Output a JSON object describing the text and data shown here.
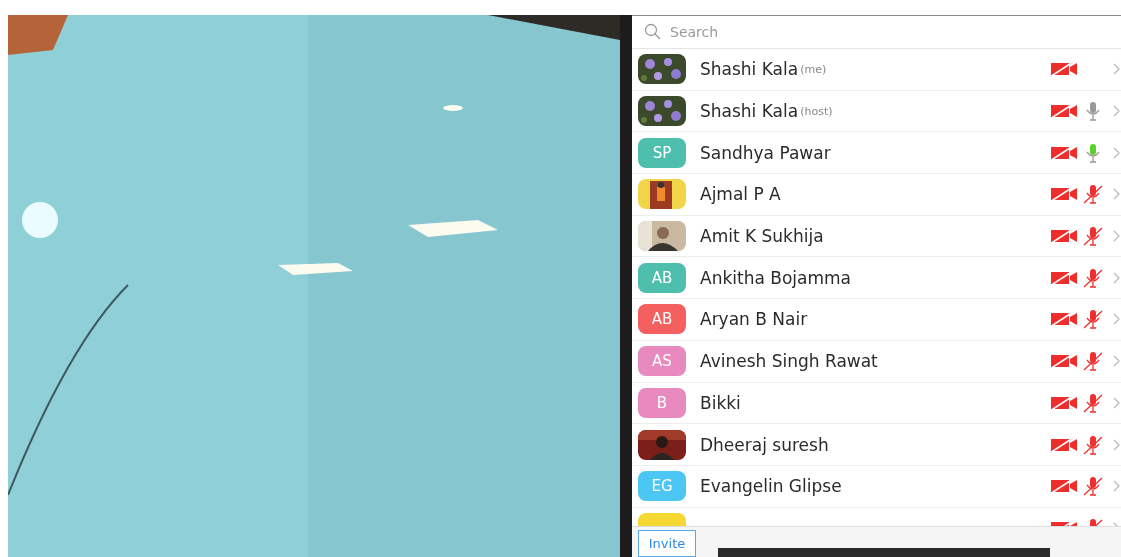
{
  "participants_panel": {
    "search": {
      "placeholder": "Search"
    },
    "participants": [
      {
        "name": "Shashi Kala",
        "tag": "(me)",
        "kind": "flowers",
        "video_off": true
      },
      {
        "name": "Shashi Kala",
        "tag": "(host)",
        "kind": "flowers",
        "video_off": true,
        "mic": {
          "muted": false,
          "speaking": false
        }
      },
      {
        "name": "Sandhya Pawar",
        "kind": "initials",
        "initials": "SP",
        "color": "#4fbfad",
        "video_off": true,
        "mic": {
          "muted": false,
          "speaking": true
        }
      },
      {
        "name": "Ajmal P A",
        "kind": "doorway",
        "video_off": true,
        "mic": {
          "muted": true
        }
      },
      {
        "name": "Amit K Sukhija",
        "kind": "portrait",
        "video_off": true,
        "mic": {
          "muted": true
        }
      },
      {
        "name": "Ankitha Bojamma",
        "kind": "initials",
        "initials": "AB",
        "color": "#4fbfad",
        "video_off": true,
        "mic": {
          "muted": true
        }
      },
      {
        "name": "Aryan B Nair",
        "kind": "initials",
        "initials": "AB",
        "color": "#f45f60",
        "video_off": true,
        "mic": {
          "muted": true
        }
      },
      {
        "name": "Avinesh Singh Rawat",
        "kind": "initials",
        "initials": "AS",
        "color": "#e889bf",
        "video_off": true,
        "mic": {
          "muted": true
        }
      },
      {
        "name": "Bikki",
        "kind": "initials",
        "initials": "B",
        "color": "#e889bf",
        "video_off": true,
        "mic": {
          "muted": true
        }
      },
      {
        "name": "Dheeraj suresh",
        "kind": "dark-portrait",
        "video_off": true,
        "mic": {
          "muted": true
        }
      },
      {
        "name": "Evangelin Glipse",
        "kind": "initials",
        "initials": "EG",
        "color": "#4cc6f2",
        "video_off": true,
        "mic": {
          "muted": true
        }
      },
      {
        "kind": "initials",
        "color": "#f6d832",
        "video_off": true,
        "mic": {
          "muted": true
        }
      }
    ],
    "invite_button": "Invite"
  }
}
